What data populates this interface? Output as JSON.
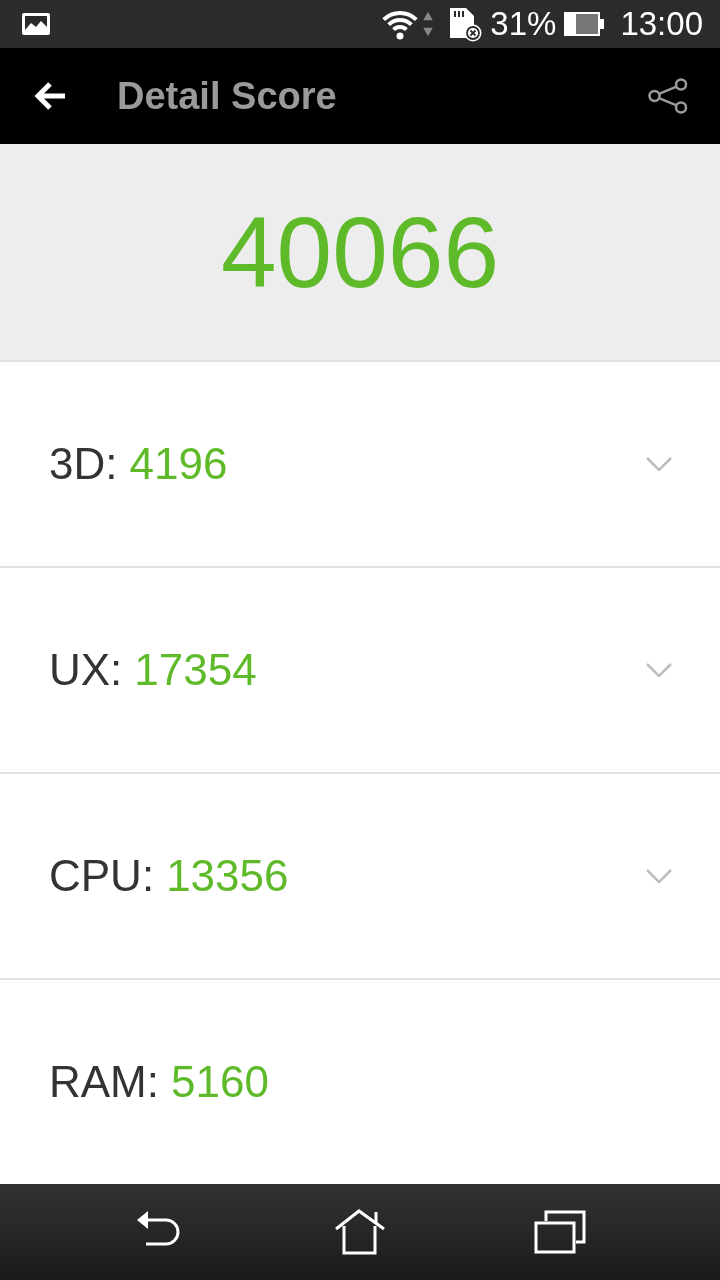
{
  "status_bar": {
    "battery": "31%",
    "time": "13:00"
  },
  "app_bar": {
    "title": "Detail Score"
  },
  "total_score": "40066",
  "scores": [
    {
      "label": "3D:",
      "value": "4196",
      "expandable": true
    },
    {
      "label": "UX:",
      "value": "17354",
      "expandable": true
    },
    {
      "label": "CPU:",
      "value": "13356",
      "expandable": true
    },
    {
      "label": "RAM:",
      "value": "5160",
      "expandable": false
    }
  ]
}
